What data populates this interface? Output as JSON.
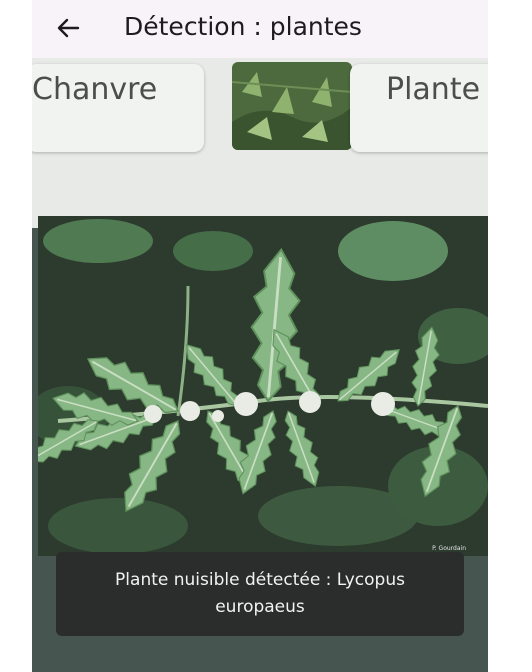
{
  "appbar": {
    "title": "Détection : plantes",
    "back_icon": "arrow-left-icon"
  },
  "preview": {
    "card_left_text": "Chanvre",
    "card_right_text": "Plante",
    "watermark": "P. Gourdain"
  },
  "snackbar": {
    "message": "Plante nuisible détectée : Lycopus europaeus"
  },
  "colors": {
    "appbar_bg": "#f8f3f9",
    "snackbar_bg": "#2b2d2c",
    "leaf_green": "#7fb07d"
  }
}
